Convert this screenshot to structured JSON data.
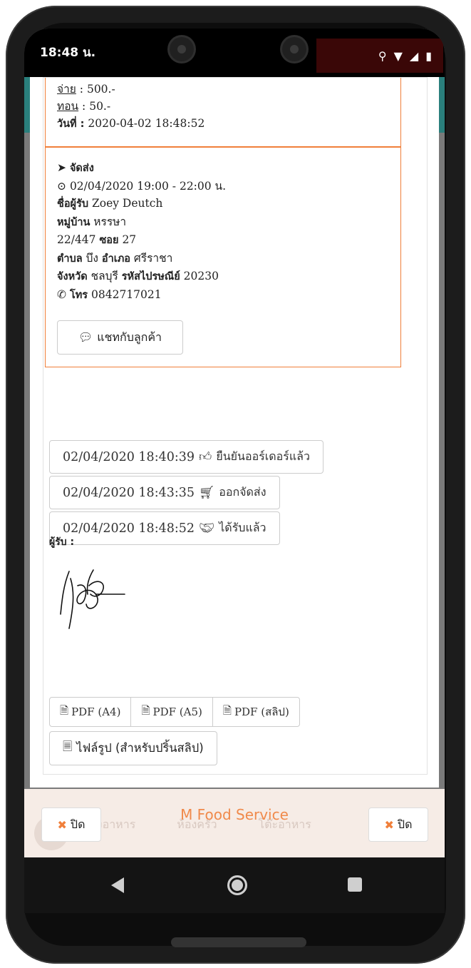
{
  "status_bar": {
    "time": "18:48 น.",
    "icons": [
      "location-icon",
      "wifi-icon",
      "signal-icon",
      "battery-icon"
    ]
  },
  "order": {
    "truncated_line": "จ่าย : 500.-",
    "pay_label": "จ่าย",
    "pay_value": " : 500.-",
    "change_label": "ทอน",
    "change_value": " : 50.-",
    "date_label": "วันที่ :",
    "date_value": " 2020-04-02 18:48:52"
  },
  "delivery": {
    "heading": "จัดส่ง",
    "slot": "02/04/2020 19:00 - 22:00 น.",
    "receiver_label": "ชื่อผู้รับ",
    "receiver_name": " Zoey Deutch",
    "village_label": "หมู่บ้าน",
    "village_value": " หรรษา",
    "address_no": "22/447 ",
    "soi_label": "ซอย",
    "soi_value": " 27",
    "subdistrict_label": "ตำบล",
    "subdistrict_value": " บึง ",
    "district_label": "อำเภอ",
    "district_value": " ศรีราชา",
    "province_label": "จังหวัด",
    "province_value": " ชลบุรี ",
    "postcode_label": "รหัสไปรษณีย์",
    "postcode_value": " 20230",
    "phone_label": "โทร",
    "phone_value": " 0842717021",
    "chat_button": "แชทกับลูกค้า"
  },
  "timeline": [
    {
      "time": "02/04/2020 18:40:39",
      "status": "ยืนยันออร์เดอร์แล้ว",
      "icon": "thumbs-up-icon"
    },
    {
      "time": "02/04/2020 18:43:35",
      "status": "ออกจัดส่ง",
      "icon": "cart-icon"
    },
    {
      "time": "02/04/2020 18:48:52",
      "status": "ได้รับแล้ว",
      "icon": "handshake-icon"
    }
  ],
  "receiver_signature_label": "ผู้รับ :",
  "export": {
    "pdf_a4": "PDF (A4)",
    "pdf_a5": "PDF (A5)",
    "pdf_slip": "PDF (สลิป)",
    "image_button": "ไฟล์รูป (สำหรับปริ้นสลิป)"
  },
  "footer": {
    "brand": "M Food Service",
    "close_left": "ปิด",
    "close_right": "ปิด",
    "background_nav": [
      "สั่งอาหาร",
      "ห้องครัว",
      "โต๊ะอาหาร"
    ]
  },
  "colors": {
    "accent": "#f07f3a",
    "teal": "#2a7f7c",
    "brand": "#f08a4b"
  }
}
